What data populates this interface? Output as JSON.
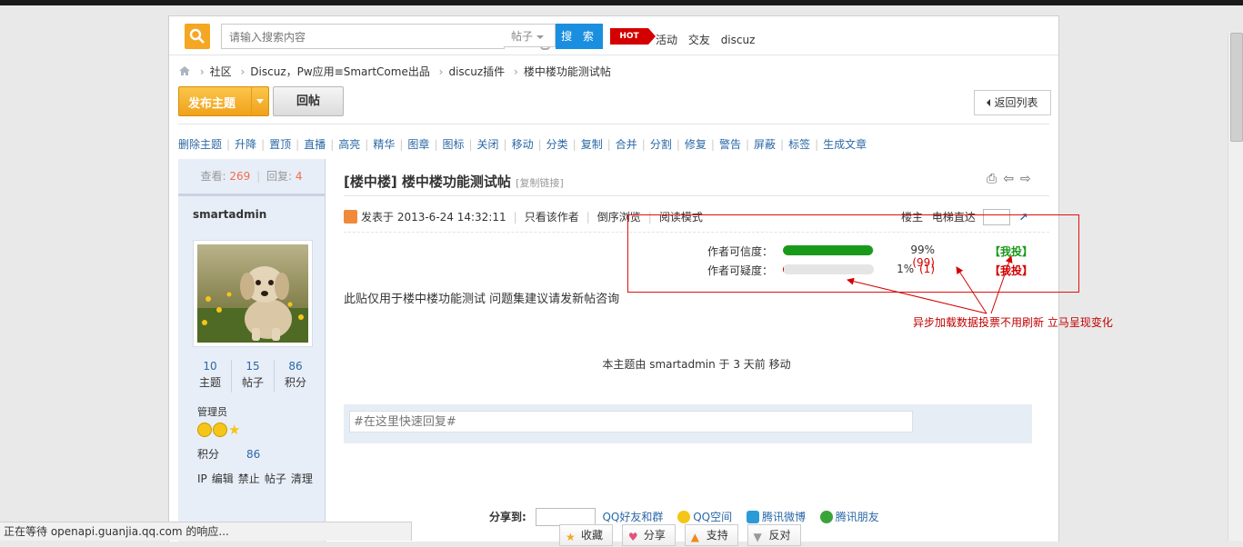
{
  "search": {
    "placeholder": "请输入搜索内容",
    "type": "帖子",
    "button": "搜 索",
    "hot_badge": "HOT",
    "hot_links": [
      "活动",
      "交友",
      "discuz"
    ]
  },
  "breadcrumb": [
    "社区",
    "Discuz，Pw应用≡SmartCome出品",
    "discuz插件",
    "楼中楼功能测试帖"
  ],
  "toolbar": {
    "post_button": "发布主题",
    "reply_button": "回帖",
    "back_button": "返回列表"
  },
  "mod_actions": [
    "删除主题",
    "升降",
    "置顶",
    "直播",
    "高亮",
    "精华",
    "图章",
    "图标",
    "关闭",
    "移动",
    "分类",
    "复制",
    "合并",
    "分割",
    "修复",
    "警告",
    "屏蔽",
    "标签",
    "生成文章"
  ],
  "sidebar": {
    "views_label": "查看:",
    "views": "269",
    "replies_label": "回复:",
    "replies": "4",
    "username": "smartadmin",
    "stats": [
      {
        "value": "10",
        "label": "主题"
      },
      {
        "value": "15",
        "label": "帖子"
      },
      {
        "value": "86",
        "label": "积分"
      }
    ],
    "role": "管理员",
    "points_label": "积分",
    "points_value": "86",
    "actions": [
      "IP",
      "编辑",
      "禁止",
      "帖子",
      "清理"
    ]
  },
  "post": {
    "title": "[楼中楼] 楼中楼功能测试帖",
    "copy_link": "[复制链接]",
    "posted": "发表于 2013-6-24 14:32:11",
    "meta_links": [
      "只看该作者",
      "倒序浏览",
      "阅读模式"
    ],
    "floor_label": "楼主",
    "elevator_label": "电梯直达",
    "content": "此贴仅用于楼中楼功能测试 问题集建议请发新帖咨询",
    "move_note": "本主题由 smartadmin 于 3 天前 移动",
    "quick_reply_placeholder": "#在这里快速回复#"
  },
  "votes": [
    {
      "label": "作者可信度：",
      "percent": 99,
      "percent_text": "99%",
      "count": "(99)",
      "link": "【我投】",
      "bar_color": "#1a9a1a",
      "link_color": "#1a9a1a"
    },
    {
      "label": "作者可疑度：",
      "percent": 1,
      "percent_text": "1%",
      "count": "(1)",
      "link": "【我投】",
      "bar_color": "#d40000",
      "link_color": "#d40000"
    }
  ],
  "share": {
    "label": "分享到:",
    "links": [
      "QQ好友和群",
      "QQ空间",
      "腾讯微博",
      "腾讯朋友"
    ]
  },
  "bottom_buttons": [
    "收藏",
    "分享",
    "支持",
    "反对"
  ],
  "annotation": "异步加载数据投票不用刷新 立马呈现变化",
  "statusbar": "正在等待 openapi.guanjia.qq.com 的响应..."
}
